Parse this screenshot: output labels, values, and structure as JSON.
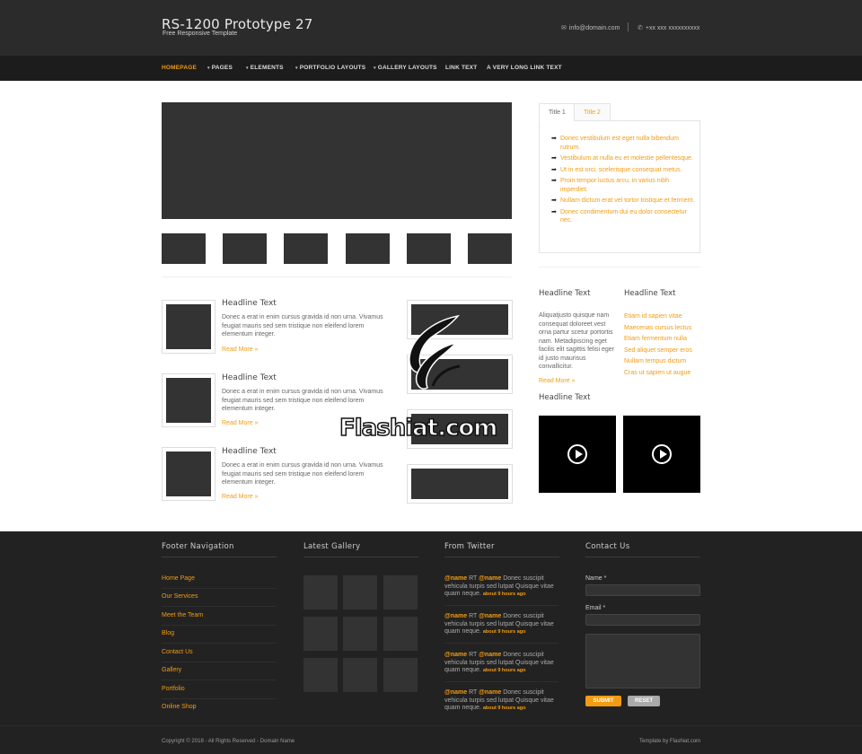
{
  "header": {
    "title": "RS-1200 Prototype 27",
    "tagline": "Free Responsive Template",
    "email": "info@domain.com",
    "phone": "+xx xxx xxxxxxxxxx"
  },
  "nav": {
    "items": [
      "HOMEPAGE",
      "PAGES",
      "ELEMENTS",
      "PORTFOLIO LAYOUTS",
      "GALLERY LAYOUTS",
      "LINK TEXT",
      "A VERY LONG LINK TEXT"
    ]
  },
  "posts": [
    {
      "title": "Headline Text",
      "text": "Donec a erat in enim cursus gravida id non urna. Vivamus feugiat mauris sed sem tristique non eleifend lorem elementum integer.",
      "more": "Read More »"
    },
    {
      "title": "Headline Text",
      "text": "Donec a erat in enim cursus gravida id non urna. Vivamus feugiat mauris sed sem tristique non eleifend lorem elementum integer.",
      "more": "Read More »"
    },
    {
      "title": "Headline Text",
      "text": "Donec a erat in enim cursus gravida id non urna. Vivamus feugiat mauris sed sem tristique non eleifend lorem elementum integer.",
      "more": "Read More »"
    }
  ],
  "tabs": {
    "labels": [
      "Title 1",
      "Title 2"
    ],
    "items": [
      "Donec vestibulum est eget nulla bibendum rutrum.",
      "Vestibulum at nulla eu et molestie pellentesque.",
      "Ut in est orci, scelerisque consequat metus.",
      "Proin tempor luctus arcu, in varius nibh imperdiet.",
      "Nullam dictum erat vel tortor tristique et ferment.",
      "Donec condimentum dui eu dolor consectetur nec."
    ]
  },
  "sidebar": {
    "head1": "Headline Text",
    "text1": "Aliquatjusto quisque nam consequat doloreet vest orna partur scetur portortis nam. Metadipiscing eget facilis elit sagittis felisi eger id justo maurisus convallicitur.",
    "more1": "Read More »",
    "head2": "Headline Text",
    "links": [
      "Etiam id sapien vitae",
      "Maecenas cursus lectus",
      "Etiam fermentum nulla",
      "Sed aliquet semper eros",
      "Nullam tempus dictum",
      "Cras ut sapien ut augue"
    ],
    "head3": "Headline Text"
  },
  "watermark": "Flashiat.com",
  "footer": {
    "nav_head": "Footer Navigation",
    "gallery_head": "Latest Gallery",
    "twitter_head": "From Twitter",
    "contact_head": "Contact Us",
    "nav_links": [
      "Home Page",
      "Our Services",
      "Meet the Team",
      "Blog",
      "Contact Us",
      "Gallery",
      "Portfolio",
      "Online Shop"
    ],
    "tweets": [
      {
        "name": "@name",
        "rt": "RT",
        "name2": "@name",
        "text": "Donec suscipit vehicula turpis sed lutpat Quisque vitae quam neque.",
        "ago": "about 9 hours ago"
      },
      {
        "name": "@name",
        "rt": "RT",
        "name2": "@name",
        "text": "Donec suscipit vehicula turpis sed lutpat Quisque vitae quam neque.",
        "ago": "about 9 hours ago"
      },
      {
        "name": "@name",
        "rt": "RT",
        "name2": "@name",
        "text": "Donec suscipit vehicula turpis sed lutpat Quisque vitae quam neque.",
        "ago": "about 9 hours ago"
      },
      {
        "name": "@name",
        "rt": "RT",
        "name2": "@name",
        "text": "Donec suscipit vehicula turpis sed lutpat Quisque vitae quam neque.",
        "ago": "about 9 hours ago"
      }
    ],
    "form": {
      "name_label": "Name *",
      "email_label": "Email *",
      "submit": "SUBMIT",
      "reset": "RESET"
    },
    "copyright": "Copyright © 2018 - All Rights Reserved - Domain Name",
    "credit": "Template by Flashiat.com"
  },
  "colors": {
    "accent": "#f39c12",
    "header_bg": "#2b2b2b",
    "nav_bg": "#1c1c1c",
    "footer_bg": "#222222"
  }
}
